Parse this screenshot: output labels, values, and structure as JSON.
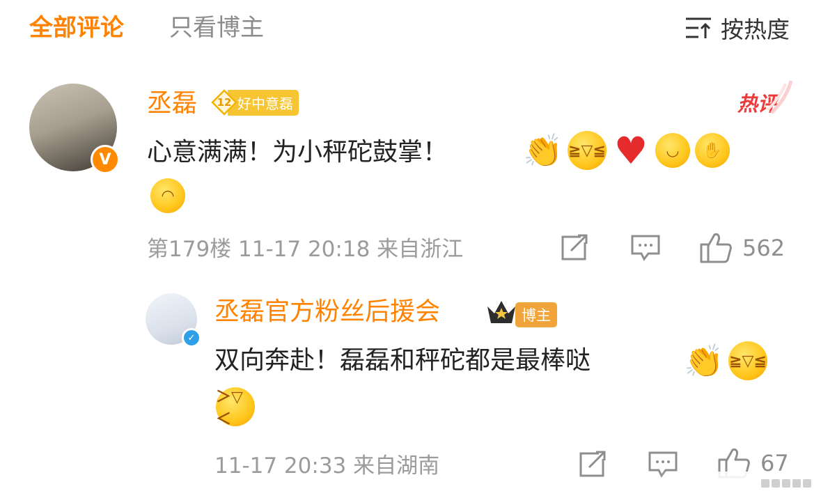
{
  "tabs": {
    "all": "全部评论",
    "owner_only": "只看博主"
  },
  "sort": {
    "label": "按热度",
    "icon": "sort-icon"
  },
  "comments": [
    {
      "user": "丞磊",
      "fan_badge": {
        "level": "12",
        "text": "好中意磊"
      },
      "hot_label": "热评",
      "text": "心意满满！为小秤砣鼓掌！",
      "emojis": [
        "clap",
        "laugh-cry",
        "heart",
        "hug",
        "raise-hand",
        "salute"
      ],
      "meta": "第179楼 11-17 20:18 来自浙江",
      "likes": "562",
      "verified": "V"
    },
    {
      "user": "丞磊官方粉丝后援会",
      "owner_badge": "博主",
      "text": "双向奔赴！磊磊和秤砣都是最棒哒",
      "emojis": [
        "clap",
        "laugh-cry",
        "cheer"
      ],
      "meta": "11-17 20:33 来自湖南",
      "likes": "67",
      "verified": "✓"
    }
  ],
  "colors": {
    "accent": "#ff8200",
    "hot": "#ee3a3a",
    "meta": "#9b9b9b",
    "text": "#222222"
  }
}
